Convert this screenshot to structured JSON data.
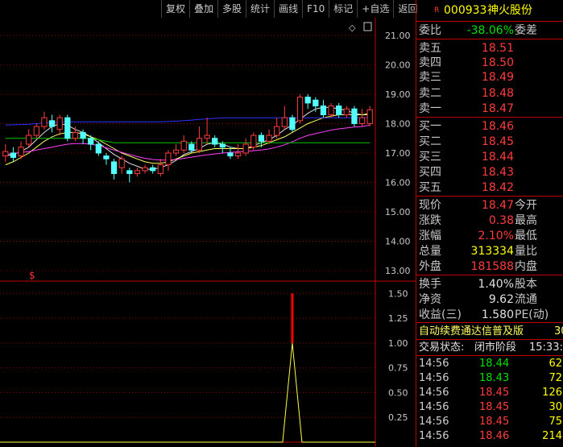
{
  "toolbar": {
    "buttons": [
      "复权",
      "叠加",
      "多股",
      "统计",
      "画线",
      "F10",
      "标记",
      "+自选",
      "返回"
    ]
  },
  "stock": {
    "marker": "R",
    "code": "000933",
    "name": "神火股份"
  },
  "price_axis": [
    "21.00",
    "20.00",
    "19.00",
    "18.00",
    "17.00",
    "16.00",
    "15.00",
    "14.00",
    "13.00"
  ],
  "indicator_axis": [
    "1.50",
    "1.25",
    "1.00",
    "0.75",
    "0.50",
    "0.25"
  ],
  "chart_marker": "$",
  "weibi": {
    "label": "委比",
    "value": "-38.06%",
    "label2": "委差"
  },
  "asks": [
    {
      "label": "卖五",
      "price": "18.51"
    },
    {
      "label": "卖四",
      "price": "18.50"
    },
    {
      "label": "卖三",
      "price": "18.49"
    },
    {
      "label": "卖二",
      "price": "18.48"
    },
    {
      "label": "卖一",
      "price": "18.47"
    }
  ],
  "bids": [
    {
      "label": "买一",
      "price": "18.46"
    },
    {
      "label": "买二",
      "price": "18.45"
    },
    {
      "label": "买三",
      "price": "18.44"
    },
    {
      "label": "买四",
      "price": "18.43"
    },
    {
      "label": "买五",
      "price": "18.42"
    }
  ],
  "quote": [
    {
      "label": "现价",
      "value": "18.47",
      "label2": "今开"
    },
    {
      "label": "涨跌",
      "value": "0.38",
      "label2": "最高"
    },
    {
      "label": "涨幅",
      "value": "2.10%",
      "label2": "最低"
    },
    {
      "label": "总量",
      "value": "313334",
      "label2": "量比"
    },
    {
      "label": "外盘",
      "value": "181588",
      "label2": "内盘"
    }
  ],
  "fundamentals": [
    {
      "label": "换手",
      "value": "1.40%",
      "label2": "股本"
    },
    {
      "label": "净资",
      "value": "9.62",
      "label2": "流通"
    },
    {
      "label": "收益(三)",
      "value": "1.580",
      "label2": "PE(动)"
    }
  ],
  "ad_text": "自动续费通达信普及版",
  "ad_num": "30",
  "trade_status": {
    "label": "交易状态:",
    "value": "闭市阶段",
    "time": "15:33:"
  },
  "ticks": [
    {
      "time": "14:56",
      "price": "18.44",
      "vol": "62"
    },
    {
      "time": "14:56",
      "price": "18.43",
      "vol": "72"
    },
    {
      "time": "14:56",
      "price": "18.45",
      "vol": "126"
    },
    {
      "time": "14:56",
      "price": "18.45",
      "vol": "30"
    },
    {
      "time": "14:56",
      "price": "18.45",
      "vol": "75"
    },
    {
      "time": "14:56",
      "price": "18.46",
      "vol": "214"
    }
  ],
  "chart_data": {
    "type": "candlestick",
    "y_range": [
      12.7,
      21.6
    ],
    "candles": [
      {
        "o": 16.9,
        "c": 17.05,
        "h": 17.3,
        "l": 16.7
      },
      {
        "o": 17.0,
        "c": 16.85,
        "h": 17.2,
        "l": 16.7
      },
      {
        "o": 16.9,
        "c": 17.2,
        "h": 17.4,
        "l": 16.8
      },
      {
        "o": 17.3,
        "c": 17.6,
        "h": 17.8,
        "l": 17.2
      },
      {
        "o": 17.6,
        "c": 17.9,
        "h": 18.0,
        "l": 17.5
      },
      {
        "o": 17.9,
        "c": 18.2,
        "h": 18.4,
        "l": 17.8
      },
      {
        "o": 18.1,
        "c": 17.9,
        "h": 18.3,
        "l": 17.7
      },
      {
        "o": 17.8,
        "c": 18.2,
        "h": 18.3,
        "l": 17.6
      },
      {
        "o": 18.2,
        "c": 17.5,
        "h": 18.3,
        "l": 17.4
      },
      {
        "o": 17.5,
        "c": 17.7,
        "h": 17.9,
        "l": 17.4
      },
      {
        "o": 17.7,
        "c": 17.5,
        "h": 17.8,
        "l": 17.3
      },
      {
        "o": 17.5,
        "c": 17.3,
        "h": 17.6,
        "l": 17.1
      },
      {
        "o": 17.3,
        "c": 17.0,
        "h": 17.4,
        "l": 16.9
      },
      {
        "o": 16.9,
        "c": 16.8,
        "h": 17.0,
        "l": 16.6
      },
      {
        "o": 16.7,
        "c": 16.3,
        "h": 16.8,
        "l": 16.1
      },
      {
        "o": 16.5,
        "c": 16.8,
        "h": 16.9,
        "l": 16.3
      },
      {
        "o": 16.4,
        "c": 16.3,
        "h": 16.5,
        "l": 16.0
      },
      {
        "o": 16.3,
        "c": 16.4,
        "h": 16.5,
        "l": 16.2
      },
      {
        "o": 16.4,
        "c": 16.5,
        "h": 16.6,
        "l": 16.3
      },
      {
        "o": 16.5,
        "c": 16.4,
        "h": 16.6,
        "l": 16.3
      },
      {
        "o": 16.3,
        "c": 16.6,
        "h": 16.8,
        "l": 16.2
      },
      {
        "o": 16.6,
        "c": 17.0,
        "h": 17.1,
        "l": 16.4
      },
      {
        "o": 17.0,
        "c": 17.1,
        "h": 17.3,
        "l": 16.9
      },
      {
        "o": 17.1,
        "c": 17.4,
        "h": 17.6,
        "l": 17.0
      },
      {
        "o": 17.3,
        "c": 17.1,
        "h": 17.4,
        "l": 17.0
      },
      {
        "o": 17.1,
        "c": 17.5,
        "h": 17.9,
        "l": 17.0
      },
      {
        "o": 17.5,
        "c": 17.6,
        "h": 18.2,
        "l": 17.3
      },
      {
        "o": 17.5,
        "c": 17.3,
        "h": 17.6,
        "l": 17.2
      },
      {
        "o": 17.3,
        "c": 17.2,
        "h": 17.4,
        "l": 17.0
      },
      {
        "o": 17.0,
        "c": 16.9,
        "h": 17.2,
        "l": 16.8
      },
      {
        "o": 16.9,
        "c": 17.0,
        "h": 17.3,
        "l": 16.8
      },
      {
        "o": 17.0,
        "c": 17.3,
        "h": 17.5,
        "l": 16.9
      },
      {
        "o": 17.2,
        "c": 17.6,
        "h": 17.7,
        "l": 17.1
      },
      {
        "o": 17.6,
        "c": 17.4,
        "h": 17.7,
        "l": 17.2
      },
      {
        "o": 17.4,
        "c": 17.6,
        "h": 17.8,
        "l": 17.3
      },
      {
        "o": 17.6,
        "c": 17.9,
        "h": 18.2,
        "l": 17.5
      },
      {
        "o": 17.9,
        "c": 18.2,
        "h": 18.6,
        "l": 17.8
      },
      {
        "o": 18.2,
        "c": 17.8,
        "h": 18.3,
        "l": 17.7
      },
      {
        "o": 18.1,
        "c": 18.9,
        "h": 19.0,
        "l": 18.0
      },
      {
        "o": 18.9,
        "c": 18.7,
        "h": 19.0,
        "l": 18.5
      },
      {
        "o": 18.8,
        "c": 18.6,
        "h": 18.9,
        "l": 18.4
      },
      {
        "o": 18.6,
        "c": 18.3,
        "h": 18.8,
        "l": 18.2
      },
      {
        "o": 18.3,
        "c": 18.6,
        "h": 18.7,
        "l": 18.2
      },
      {
        "o": 18.6,
        "c": 18.3,
        "h": 18.7,
        "l": 18.2
      },
      {
        "o": 18.3,
        "c": 18.5,
        "h": 18.6,
        "l": 18.2
      },
      {
        "o": 18.5,
        "c": 18.0,
        "h": 18.6,
        "l": 17.9
      },
      {
        "o": 18.0,
        "c": 18.2,
        "h": 18.5,
        "l": 17.9
      },
      {
        "o": 18.0,
        "c": 18.47,
        "h": 18.6,
        "l": 17.9
      }
    ],
    "ma_lines": [
      {
        "color": "#e0e0e0",
        "values": [
          16.9,
          16.95,
          17.05,
          17.2,
          17.45,
          17.7,
          17.9,
          18.0,
          17.95,
          17.8,
          17.7,
          17.55,
          17.35,
          17.15,
          16.95,
          16.8,
          16.65,
          16.55,
          16.45,
          16.45,
          16.5,
          16.6,
          16.75,
          16.95,
          17.05,
          17.15,
          17.3,
          17.35,
          17.3,
          17.2,
          17.15,
          17.15,
          17.25,
          17.35,
          17.45,
          17.6,
          17.8,
          17.95,
          18.15,
          18.35,
          18.5,
          18.55,
          18.55,
          18.5,
          18.45,
          18.35,
          18.3,
          18.3
        ]
      },
      {
        "color": "#ffff60",
        "values": [
          16.6,
          16.7,
          16.85,
          17.0,
          17.2,
          17.4,
          17.55,
          17.65,
          17.7,
          17.7,
          17.65,
          17.55,
          17.45,
          17.3,
          17.15,
          17.0,
          16.9,
          16.8,
          16.7,
          16.65,
          16.65,
          16.7,
          16.8,
          16.9,
          17.0,
          17.05,
          17.1,
          17.15,
          17.15,
          17.15,
          17.15,
          17.15,
          17.2,
          17.25,
          17.35,
          17.45,
          17.55,
          17.7,
          17.85,
          18.0,
          18.1,
          18.2,
          18.25,
          18.3,
          18.3,
          18.3,
          18.3,
          18.35
        ]
      },
      {
        "color": "#ff40ff",
        "values": [
          16.95,
          16.98,
          17.02,
          17.05,
          17.1,
          17.15,
          17.2,
          17.25,
          17.3,
          17.32,
          17.32,
          17.3,
          17.25,
          17.18,
          17.1,
          17.02,
          16.95,
          16.88,
          16.82,
          16.78,
          16.76,
          16.76,
          16.78,
          16.82,
          16.86,
          16.9,
          16.94,
          16.97,
          17.0,
          17.02,
          17.04,
          17.06,
          17.08,
          17.1,
          17.14,
          17.2,
          17.28,
          17.38,
          17.5,
          17.6,
          17.66,
          17.72,
          17.78,
          17.82,
          17.85,
          17.88,
          17.9,
          17.95
        ]
      },
      {
        "color": "#00c800",
        "values": [
          17.5,
          17.5,
          17.5,
          17.5,
          17.5,
          17.5,
          17.5,
          17.5,
          17.5,
          17.5,
          17.5,
          17.5,
          17.45,
          17.4,
          17.35,
          17.35,
          17.35,
          17.35,
          17.35,
          17.35,
          17.35,
          17.35,
          17.35,
          17.35,
          17.35,
          17.35,
          17.35,
          17.35,
          17.35,
          17.35,
          17.35,
          17.35,
          17.35,
          17.35,
          17.35,
          17.35,
          17.35,
          17.35,
          17.35,
          17.35,
          17.35,
          17.35,
          17.35,
          17.35,
          17.35,
          17.35,
          17.35,
          17.35
        ]
      },
      {
        "color": "#3030ff",
        "values": [
          17.95,
          17.96,
          17.97,
          17.98,
          18.0,
          18.02,
          18.04,
          18.05,
          18.06,
          18.06,
          18.06,
          18.06,
          18.06,
          18.06,
          18.06,
          18.06,
          18.06,
          18.06,
          18.06,
          18.06,
          18.06,
          18.07,
          18.08,
          18.1,
          18.12,
          18.14,
          18.16,
          18.18,
          18.2,
          18.2,
          18.2,
          18.2,
          18.2,
          18.2,
          18.2,
          18.2,
          18.2,
          18.2,
          18.2,
          18.2,
          18.2,
          18.2,
          18.2,
          18.2,
          18.2,
          18.2,
          18.2,
          18.2
        ]
      }
    ],
    "indicator": {
      "y_range": [
        0,
        1.6
      ],
      "spike_index": 37,
      "spike_value": 1.0,
      "spike_top": 1.5
    }
  }
}
